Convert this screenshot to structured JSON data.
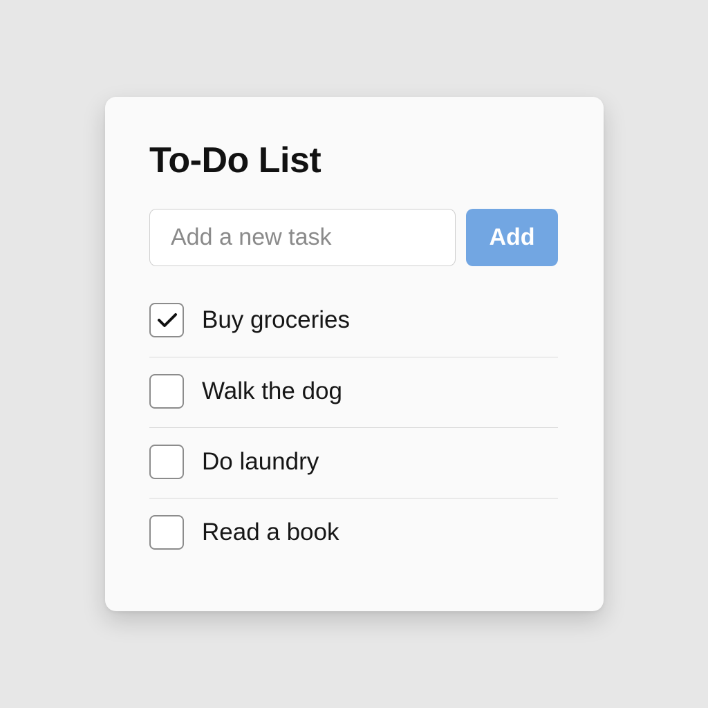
{
  "app": {
    "title": "To-Do List"
  },
  "new_task": {
    "value": "",
    "placeholder": "Add a new task",
    "add_label": "Add",
    "accent_color": "#72a6e2"
  },
  "tasks": [
    {
      "label": "Buy groceries",
      "checked": true
    },
    {
      "label": "Walk the dog",
      "checked": false
    },
    {
      "label": "Do laundry",
      "checked": false
    },
    {
      "label": "Read a book",
      "checked": false
    }
  ],
  "icons": {
    "checkmark": "check-icon"
  }
}
